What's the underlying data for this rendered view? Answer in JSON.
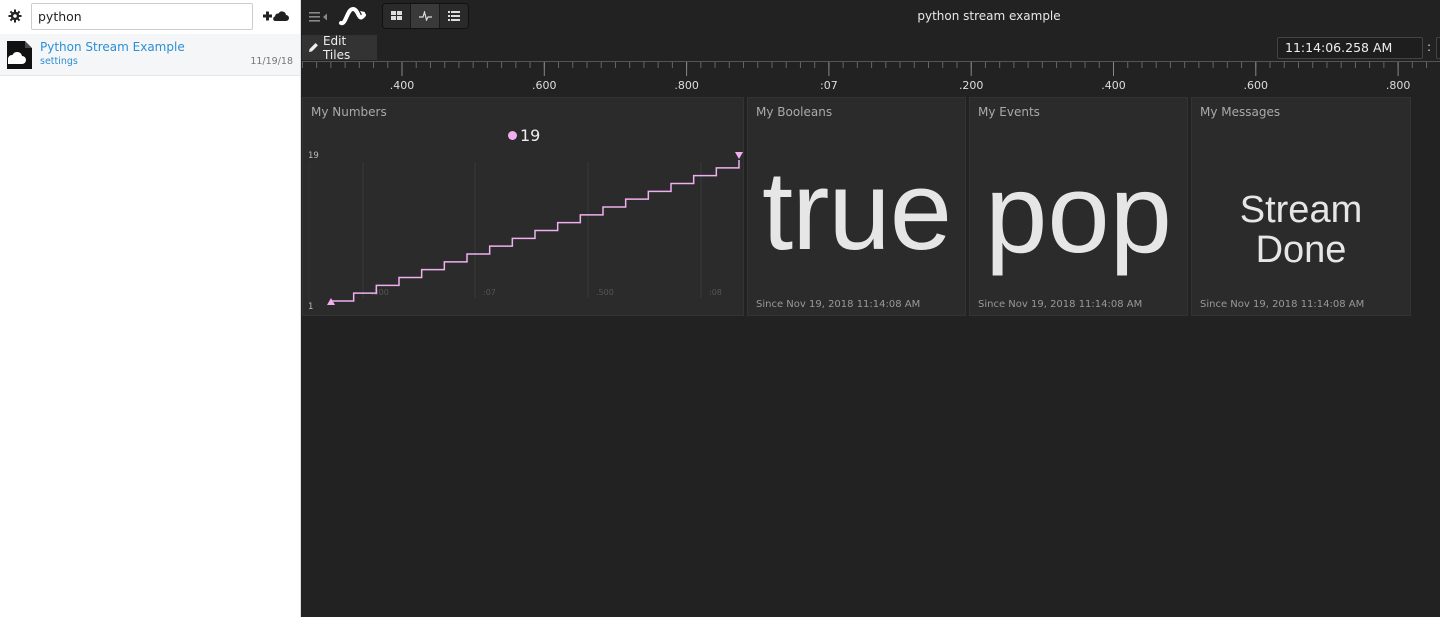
{
  "sidebar": {
    "gear_icon": "gear-icon",
    "search": {
      "value": "python",
      "placeholder": ""
    },
    "add_button_icon": "plus-cloud-icon",
    "items": [
      {
        "title": "Python Stream Example",
        "subtitle": "settings",
        "date": "11/19/18",
        "icon": "cloud-file-icon"
      }
    ]
  },
  "toolbar": {
    "title": "python stream example",
    "view_buttons": [
      {
        "name": "grid-view",
        "icon": "grid-icon",
        "active": false
      },
      {
        "name": "stream-view",
        "icon": "pulse-icon",
        "active": true
      },
      {
        "name": "list-view",
        "icon": "list-icon",
        "active": false
      }
    ],
    "edit_tiles_label": "Edit Tiles",
    "clock": "11:14:06.258 AM",
    "clock_separator": ":"
  },
  "ruler": {
    "labels": [
      ".400",
      ".600",
      ".800",
      ":07",
      ".200",
      ".400",
      ".600",
      ".800"
    ]
  },
  "tiles": {
    "numbers": {
      "name": "My Numbers",
      "legend_value": "19",
      "color": "#f0b0f0"
    },
    "booleans": {
      "name": "My Booleans",
      "value": "true",
      "since": "Since Nov 19, 2018 11:14:08 AM"
    },
    "events": {
      "name": "My Events",
      "value": "pop",
      "since": "Since Nov 19, 2018 11:14:08 AM"
    },
    "messages": {
      "name": "My Messages",
      "value": "Stream Done",
      "since": "Since Nov 19, 2018 11:14:08 AM"
    }
  },
  "chart_data": {
    "type": "line",
    "title": "My Numbers",
    "step": true,
    "series": [
      {
        "name": "My Numbers",
        "color": "#f0b0f0",
        "values": [
          1,
          2,
          3,
          4,
          5,
          6,
          7,
          8,
          9,
          10,
          11,
          12,
          13,
          14,
          15,
          16,
          17,
          18,
          19
        ]
      }
    ],
    "ylim": [
      1,
      19
    ],
    "ytick_labels": [
      "19",
      "1"
    ],
    "xtick_labels": [
      ".300",
      ":07",
      ".500",
      ":08"
    ],
    "grid": true,
    "legend": "top-center"
  }
}
